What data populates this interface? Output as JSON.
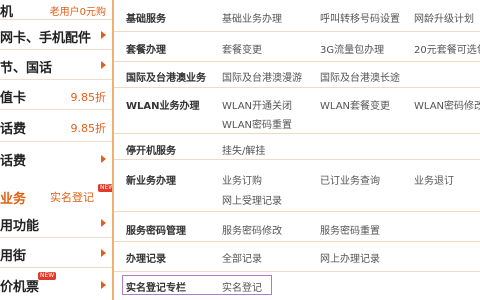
{
  "sidebar": {
    "rows": [
      {
        "label": "机",
        "sub": "老用户0元购",
        "kind": "sub"
      },
      {
        "label": "网卡、手机配件",
        "kind": "arrow"
      },
      {
        "label": "节、国话",
        "kind": "arrow"
      },
      {
        "label": "值卡",
        "discount": "9.85折",
        "kind": "disc"
      },
      {
        "label": "话费",
        "discount": "9.85折",
        "kind": "disc"
      },
      {
        "label": "话费",
        "kind": "arrow"
      }
    ],
    "business": {
      "label": "业务",
      "link": "实名登记",
      "badge": "NEW"
    },
    "rows2": [
      {
        "label": "用功能",
        "kind": "arrow"
      },
      {
        "label": "用街",
        "kind": "arrow"
      },
      {
        "label": "价机票",
        "badge": "NEW",
        "kind": "arrow"
      }
    ]
  },
  "services": [
    {
      "category": "基础服务",
      "items": [
        "基础业务办理",
        "呼叫转移号码设置",
        "网龄升级计划"
      ]
    },
    {
      "category": "套餐办理",
      "items": [
        "套餐变更",
        "3G流量包办理",
        "20元套餐可选包"
      ]
    },
    {
      "category": "国际及台港澳业务",
      "items": [
        "国际及台港澳漫游",
        "国际及台港澳长途"
      ]
    },
    {
      "category": "WLAN业务办理",
      "items": [
        "WLAN开通关闭",
        "WLAN套餐变更",
        "WLAN密码修改",
        "WLAN密码重置"
      ]
    },
    {
      "category": "停开机服务",
      "items": [
        "挂失/解挂"
      ]
    },
    {
      "category": "新业务办理",
      "items": [
        "业务订购",
        "已订业务查询",
        "业务退订",
        "网上受理记录"
      ]
    },
    {
      "category": "服务密码管理",
      "items": [
        "服务密码修改",
        "服务密码重置"
      ]
    },
    {
      "category": "办理记录",
      "items": [
        "全部记录",
        "网上办理记录"
      ]
    },
    {
      "category": "实名登记专栏",
      "items": [
        "实名登记"
      ]
    }
  ],
  "colors": {
    "accent": "#e0601a",
    "border": "#f0b070",
    "highlight": "#b07ac8"
  }
}
